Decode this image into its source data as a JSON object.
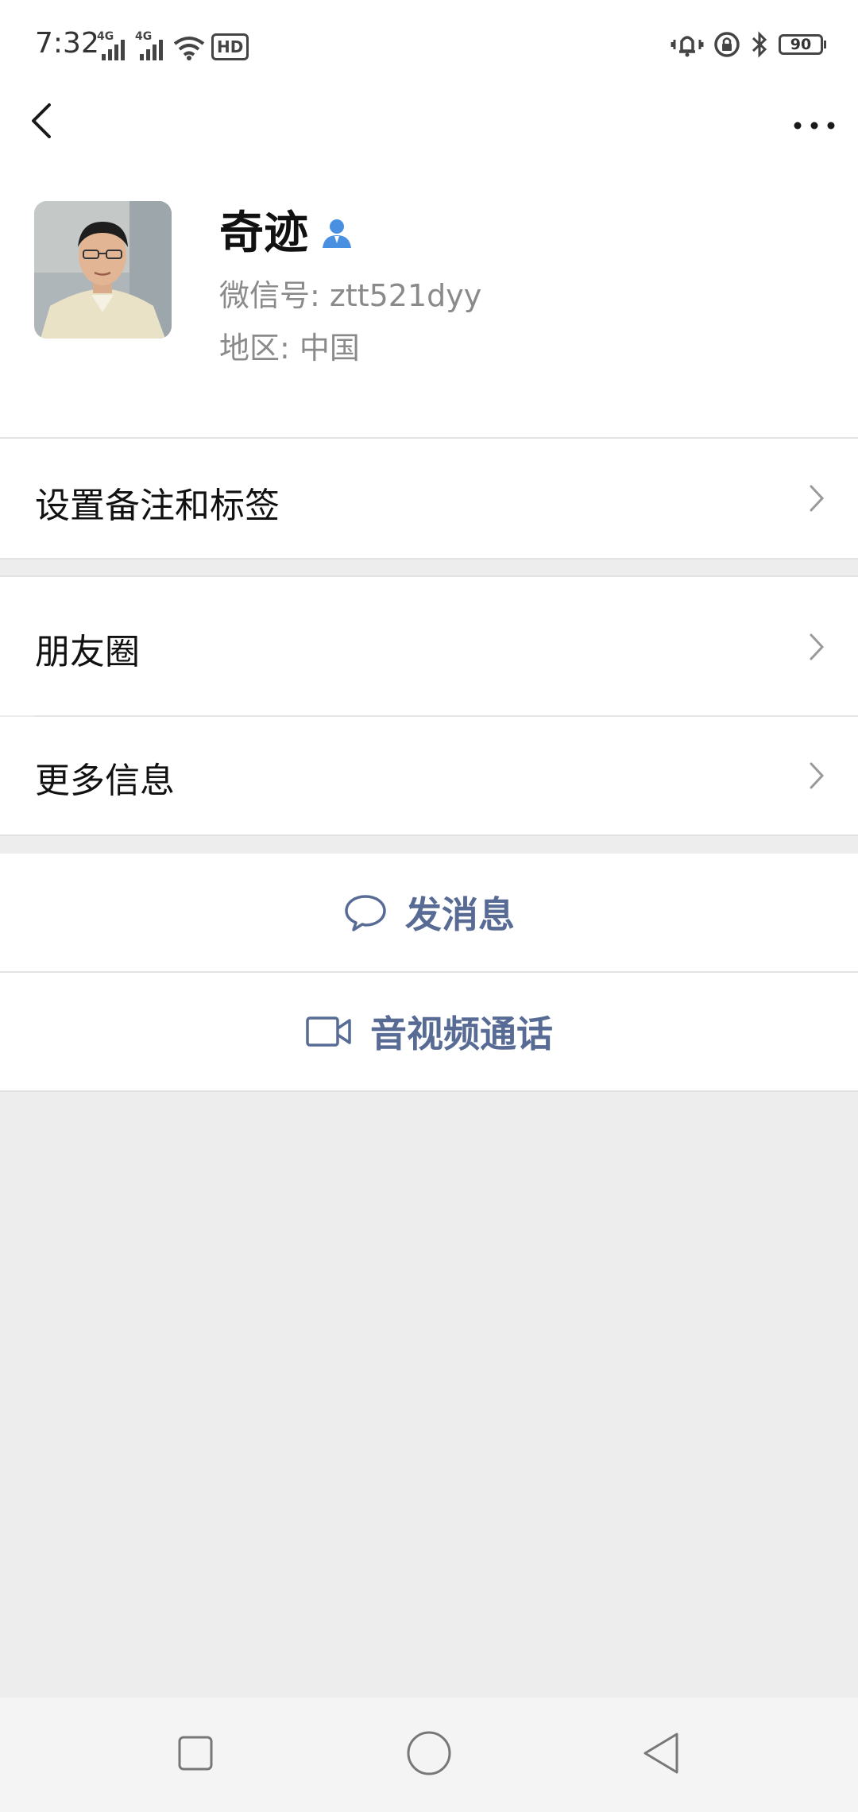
{
  "status_bar": {
    "time": "7:32",
    "network_1": "4G",
    "network_2": "4G",
    "hd_badge": "HD",
    "battery": "90"
  },
  "profile": {
    "name": "奇迹",
    "wechat_id": "微信号: ztt521dyy",
    "region": "地区: 中国"
  },
  "cells": {
    "remark_label": "设置备注和标签",
    "moments_label": "朋友圈",
    "more_info_label": "更多信息"
  },
  "actions": {
    "send_message_label": "发消息",
    "video_call_label": "音视频通话"
  },
  "colors": {
    "link_blue": "#576b95",
    "contact_icon_blue": "#4a90e2",
    "background_gray": "#ededed"
  },
  "icons": {
    "back": "chevron-left-icon",
    "more": "more-horizontal-icon",
    "contact": "person-icon",
    "chevron": "chevron-right-icon",
    "message": "chat-bubble-icon",
    "video": "video-camera-icon"
  }
}
